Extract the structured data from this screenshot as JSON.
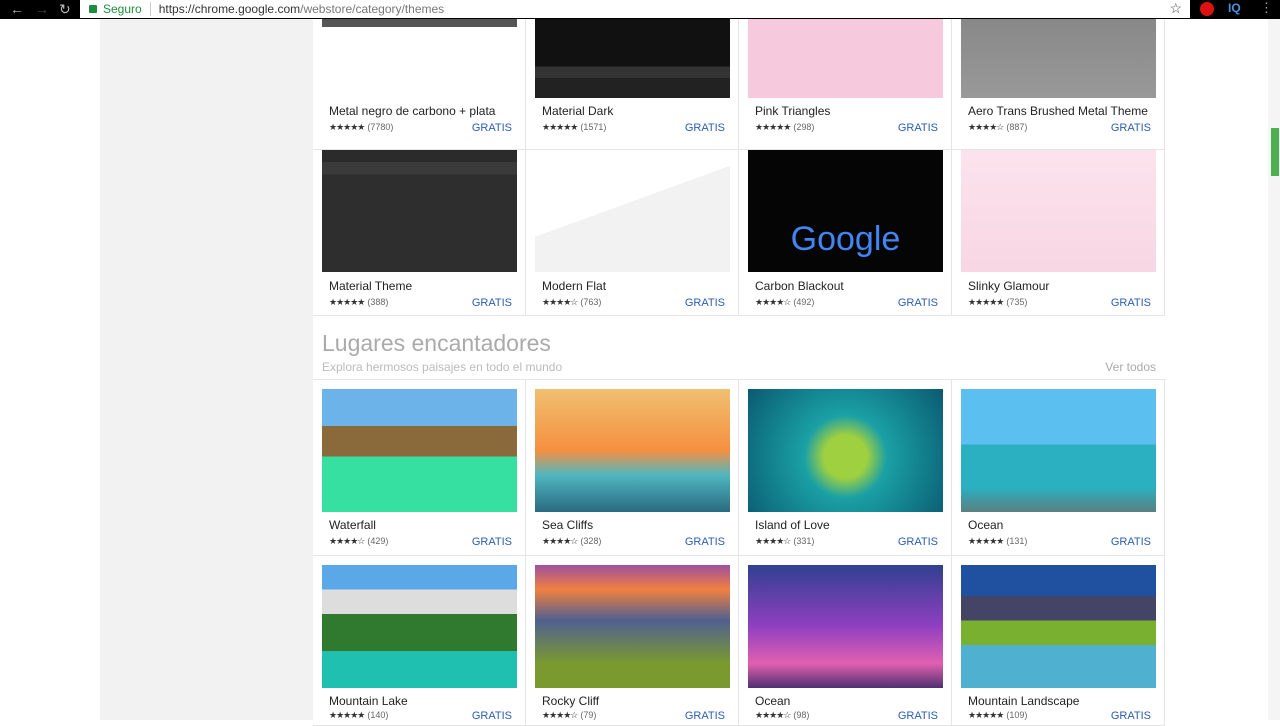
{
  "browser": {
    "secure_label": "Seguro",
    "url_host": "https://chrome.google.com",
    "url_path": "/webstore/category/themes",
    "ext_label": "IQ"
  },
  "rows": [
    {
      "items": [
        {
          "name": "Metal negro de carbono + plata",
          "stars": 5,
          "count": "(7780)",
          "price": "GRATIS"
        },
        {
          "name": "Material Dark",
          "stars": 4.5,
          "count": "(1571)",
          "price": "GRATIS"
        },
        {
          "name": "Pink Triangles",
          "stars": 4.5,
          "count": "(298)",
          "price": "GRATIS"
        },
        {
          "name": "Aero Trans Brushed Metal Theme",
          "stars": 4,
          "count": "(887)",
          "price": "GRATIS"
        }
      ]
    },
    {
      "items": [
        {
          "name": "Material Theme",
          "stars": 4.5,
          "count": "(388)",
          "price": "GRATIS"
        },
        {
          "name": "Modern Flat",
          "stars": 4,
          "count": "(763)",
          "price": "GRATIS"
        },
        {
          "name": "Carbon Blackout",
          "stars": 4,
          "count": "(492)",
          "price": "GRATIS",
          "thumb_text": "Google"
        },
        {
          "name": "Slinky Glamour",
          "stars": 4.5,
          "count": "(735)",
          "price": "GRATIS"
        }
      ]
    },
    {
      "items": [
        {
          "name": "Waterfall",
          "stars": 4,
          "count": "(429)",
          "price": "GRATIS"
        },
        {
          "name": "Sea Cliffs",
          "stars": 4,
          "count": "(328)",
          "price": "GRATIS"
        },
        {
          "name": "Island of Love",
          "stars": 4,
          "count": "(331)",
          "price": "GRATIS"
        },
        {
          "name": "Ocean",
          "stars": 4.5,
          "count": "(131)",
          "price": "GRATIS"
        }
      ]
    },
    {
      "items": [
        {
          "name": "Mountain Lake",
          "stars": 4.5,
          "count": "(140)",
          "price": "GRATIS"
        },
        {
          "name": "Rocky Cliff",
          "stars": 4,
          "count": "(79)",
          "price": "GRATIS"
        },
        {
          "name": "Ocean",
          "stars": 4,
          "count": "(98)",
          "price": "GRATIS"
        },
        {
          "name": "Mountain Landscape",
          "stars": 4.5,
          "count": "(109)",
          "price": "GRATIS"
        }
      ]
    }
  ],
  "section": {
    "title": "Lugares encantadores",
    "subtitle": "Explora hermosos paisajes en todo el mundo",
    "see_all": "Ver todos"
  }
}
